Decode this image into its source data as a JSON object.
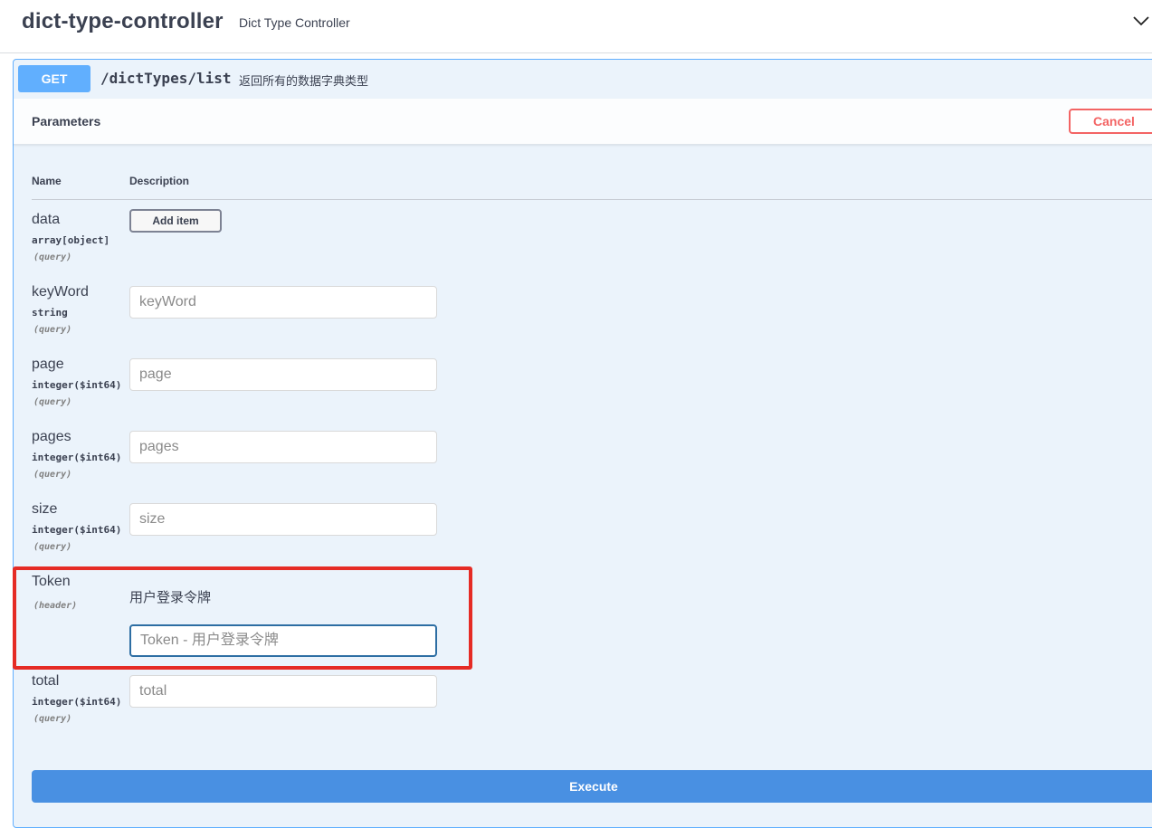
{
  "tag": {
    "name": "dict-type-controller",
    "description": "Dict Type Controller",
    "toggle_icon": "chevron-down-icon"
  },
  "operation": {
    "method": "GET",
    "path": "/dictTypes/list",
    "summary": "返回所有的数据字典类型",
    "method_color": "#61affe"
  },
  "parameters_section": {
    "title": "Parameters",
    "cancel_label": "Cancel",
    "col_name": "Name",
    "col_description": "Description"
  },
  "params": [
    {
      "name": "data",
      "type": "array[object]",
      "in": "(query)",
      "button": "Add item"
    },
    {
      "name": "keyWord",
      "type": "string",
      "in": "(query)",
      "placeholder": "keyWord"
    },
    {
      "name": "page",
      "type": "integer($int64)",
      "in": "(query)",
      "placeholder": "page"
    },
    {
      "name": "pages",
      "type": "integer($int64)",
      "in": "(query)",
      "placeholder": "pages"
    },
    {
      "name": "size",
      "type": "integer($int64)",
      "in": "(query)",
      "placeholder": "size"
    },
    {
      "name": "Token",
      "in": "(header)",
      "description": "用户登录令牌",
      "placeholder": "Token - 用户登录令牌"
    },
    {
      "name": "total",
      "type": "integer($int64)",
      "in": "(query)",
      "placeholder": "total"
    }
  ],
  "execute_label": "Execute",
  "colors": {
    "highlight": "#e52b25",
    "execute": "#4990e2",
    "cancel": "#f36464"
  }
}
